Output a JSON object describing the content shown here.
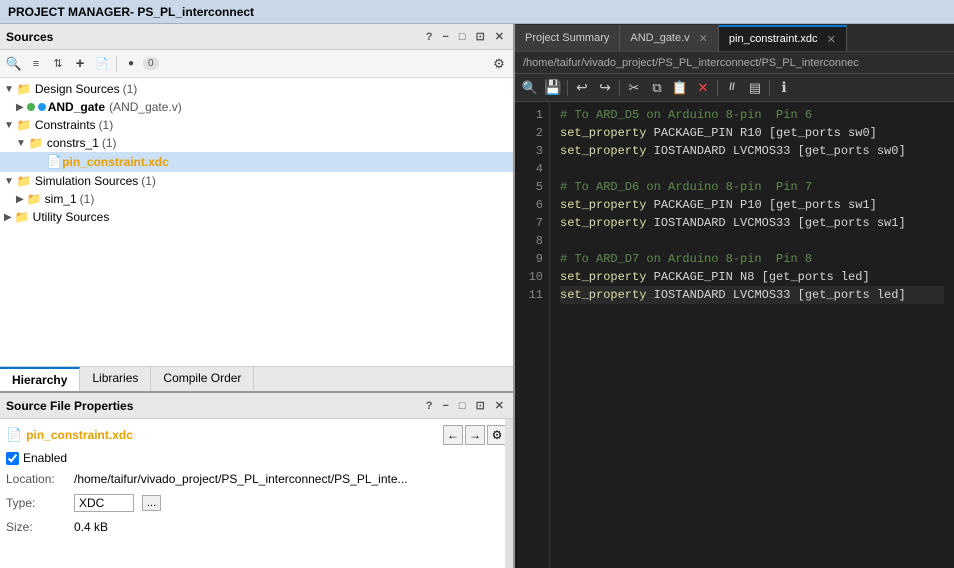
{
  "title_bar": {
    "text": "PROJECT MANAGER",
    "project_name": " - PS_PL_interconnect"
  },
  "sources_panel": {
    "title": "Sources",
    "question_mark": "?",
    "minimize": "−",
    "restore": "□",
    "float": "⊡",
    "close": "✕",
    "toolbar": {
      "search_icon": "🔍",
      "filter1_icon": "≡↑",
      "filter2_icon": "↕",
      "add_icon": "+",
      "doc_icon": "📄",
      "badge": "0",
      "gear_icon": "⚙"
    },
    "tree": {
      "design_sources": {
        "label": "Design Sources",
        "count": "(1)",
        "expanded": true,
        "children": [
          {
            "label": "AND_gate",
            "detail": "(AND_gate.v)",
            "type": "module",
            "expanded": false
          }
        ]
      },
      "constraints": {
        "label": "Constraints",
        "count": "(1)",
        "expanded": true,
        "children": [
          {
            "label": "constrs_1",
            "count": "(1)",
            "expanded": true,
            "children": [
              {
                "label": "pin_constraint.xdc",
                "type": "xdc",
                "selected": true
              }
            ]
          }
        ]
      },
      "simulation_sources": {
        "label": "Simulation Sources",
        "count": "(1)",
        "expanded": true,
        "children": [
          {
            "label": "sim_1",
            "count": "(1)",
            "expanded": false
          }
        ]
      },
      "utility_sources": {
        "label": "Utility Sources",
        "expanded": false
      }
    }
  },
  "tabs": {
    "hierarchy": "Hierarchy",
    "libraries": "Libraries",
    "compile_order": "Compile Order",
    "active": "Hierarchy"
  },
  "sfp_panel": {
    "title": "Source File Properties",
    "question_mark": "?",
    "minimize": "−",
    "restore": "□",
    "float": "⊡",
    "close": "✕",
    "filename": "pin_constraint.xdc",
    "enabled_label": "Enabled",
    "enabled_checked": true,
    "location_label": "Location:",
    "location_value": "/home/taifur/vivado_project/PS_PL_interconnect/PS_PL_inte...",
    "type_label": "Type:",
    "type_value": "XDC",
    "type_btn": "...",
    "size_label": "Size:",
    "size_value": "0.4 kB"
  },
  "editor": {
    "tabs": [
      {
        "label": "Project Summary",
        "closeable": false,
        "active": false
      },
      {
        "label": "AND_gate.v",
        "closeable": true,
        "active": false
      },
      {
        "label": "pin_constraint.xdc",
        "closeable": true,
        "active": true
      }
    ],
    "path": "/home/taifur/vivado_project/PS_PL_interconnect/PS_PL_interconnec",
    "toolbar": {
      "search": "🔍",
      "save": "💾",
      "undo": "↩",
      "redo": "↪",
      "cut": "✂",
      "copy": "⧉",
      "paste": "📋",
      "delete": "✕",
      "comment": "//",
      "block": "▤",
      "info": "ℹ"
    },
    "lines": [
      {
        "num": 1,
        "text": "# To ARD_D5 on Arduino 8-pin  Pin 6",
        "type": "comment"
      },
      {
        "num": 2,
        "text": "set_property PACKAGE_PIN R10 [get_ports sw0]",
        "type": "code"
      },
      {
        "num": 3,
        "text": "set_property IOSTANDARD LVCMOS33 [get_ports sw0]",
        "type": "code"
      },
      {
        "num": 4,
        "text": "",
        "type": "empty"
      },
      {
        "num": 5,
        "text": "# To ARD_D6 on Arduino 8-pin  Pin 7",
        "type": "comment"
      },
      {
        "num": 6,
        "text": "set_property PACKAGE_PIN P10 [get_ports sw1]",
        "type": "code"
      },
      {
        "num": 7,
        "text": "set_property IOSTANDARD LVCMOS33 [get_ports sw1]",
        "type": "code"
      },
      {
        "num": 8,
        "text": "",
        "type": "empty"
      },
      {
        "num": 9,
        "text": "# To ARD_D7 on Arduino 8-pin  Pin 8",
        "type": "comment"
      },
      {
        "num": 10,
        "text": "set_property PACKAGE_PIN N8 [get_ports led]",
        "type": "code"
      },
      {
        "num": 11,
        "text": "set_property IOSTANDARD LVCMOS33 [get_ports led]",
        "type": "code_hl"
      }
    ]
  }
}
